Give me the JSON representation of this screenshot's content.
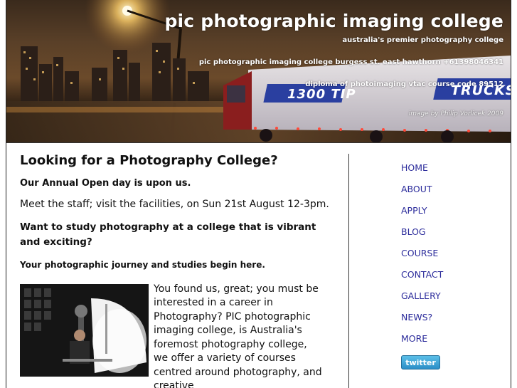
{
  "banner": {
    "title": "pic photographic imaging college",
    "tagline": "australia's premier photography college",
    "address": "pic photographic imaging college burgess st. east hawthorn +61398046341",
    "diploma": "diploma of photoimaging vtac course code 89512",
    "credit": "image by Philip Vorlicek 2009",
    "truck_text_1": "1300 TIP",
    "truck_text_2": "TRUCKS"
  },
  "main": {
    "heading": "Looking for a Photography College?",
    "open_day": "Our Annual Open day is upon us.",
    "meet": "Meet the staff; visit the facilities, on Sun 21st August 12-3pm.",
    "question": "Want to study photography at a college that is vibrant and exciting?",
    "journey": "Your photographic journey and studies begin here.",
    "intro": "You found us, great; you must be interested in a career in Photography? PIC photographic imaging college, is Australia's foremost photography college, we offer a variety of courses centred around photography, and creative"
  },
  "nav": {
    "items": [
      "HOME",
      "ABOUT",
      "APPLY",
      "BLOG",
      "COURSE",
      "CONTACT",
      "GALLERY",
      "NEWS?",
      "MORE"
    ],
    "twitter_label": "twitter"
  },
  "colors": {
    "nav_link": "#2b2b9b",
    "twitter": "#3aa2d6"
  }
}
